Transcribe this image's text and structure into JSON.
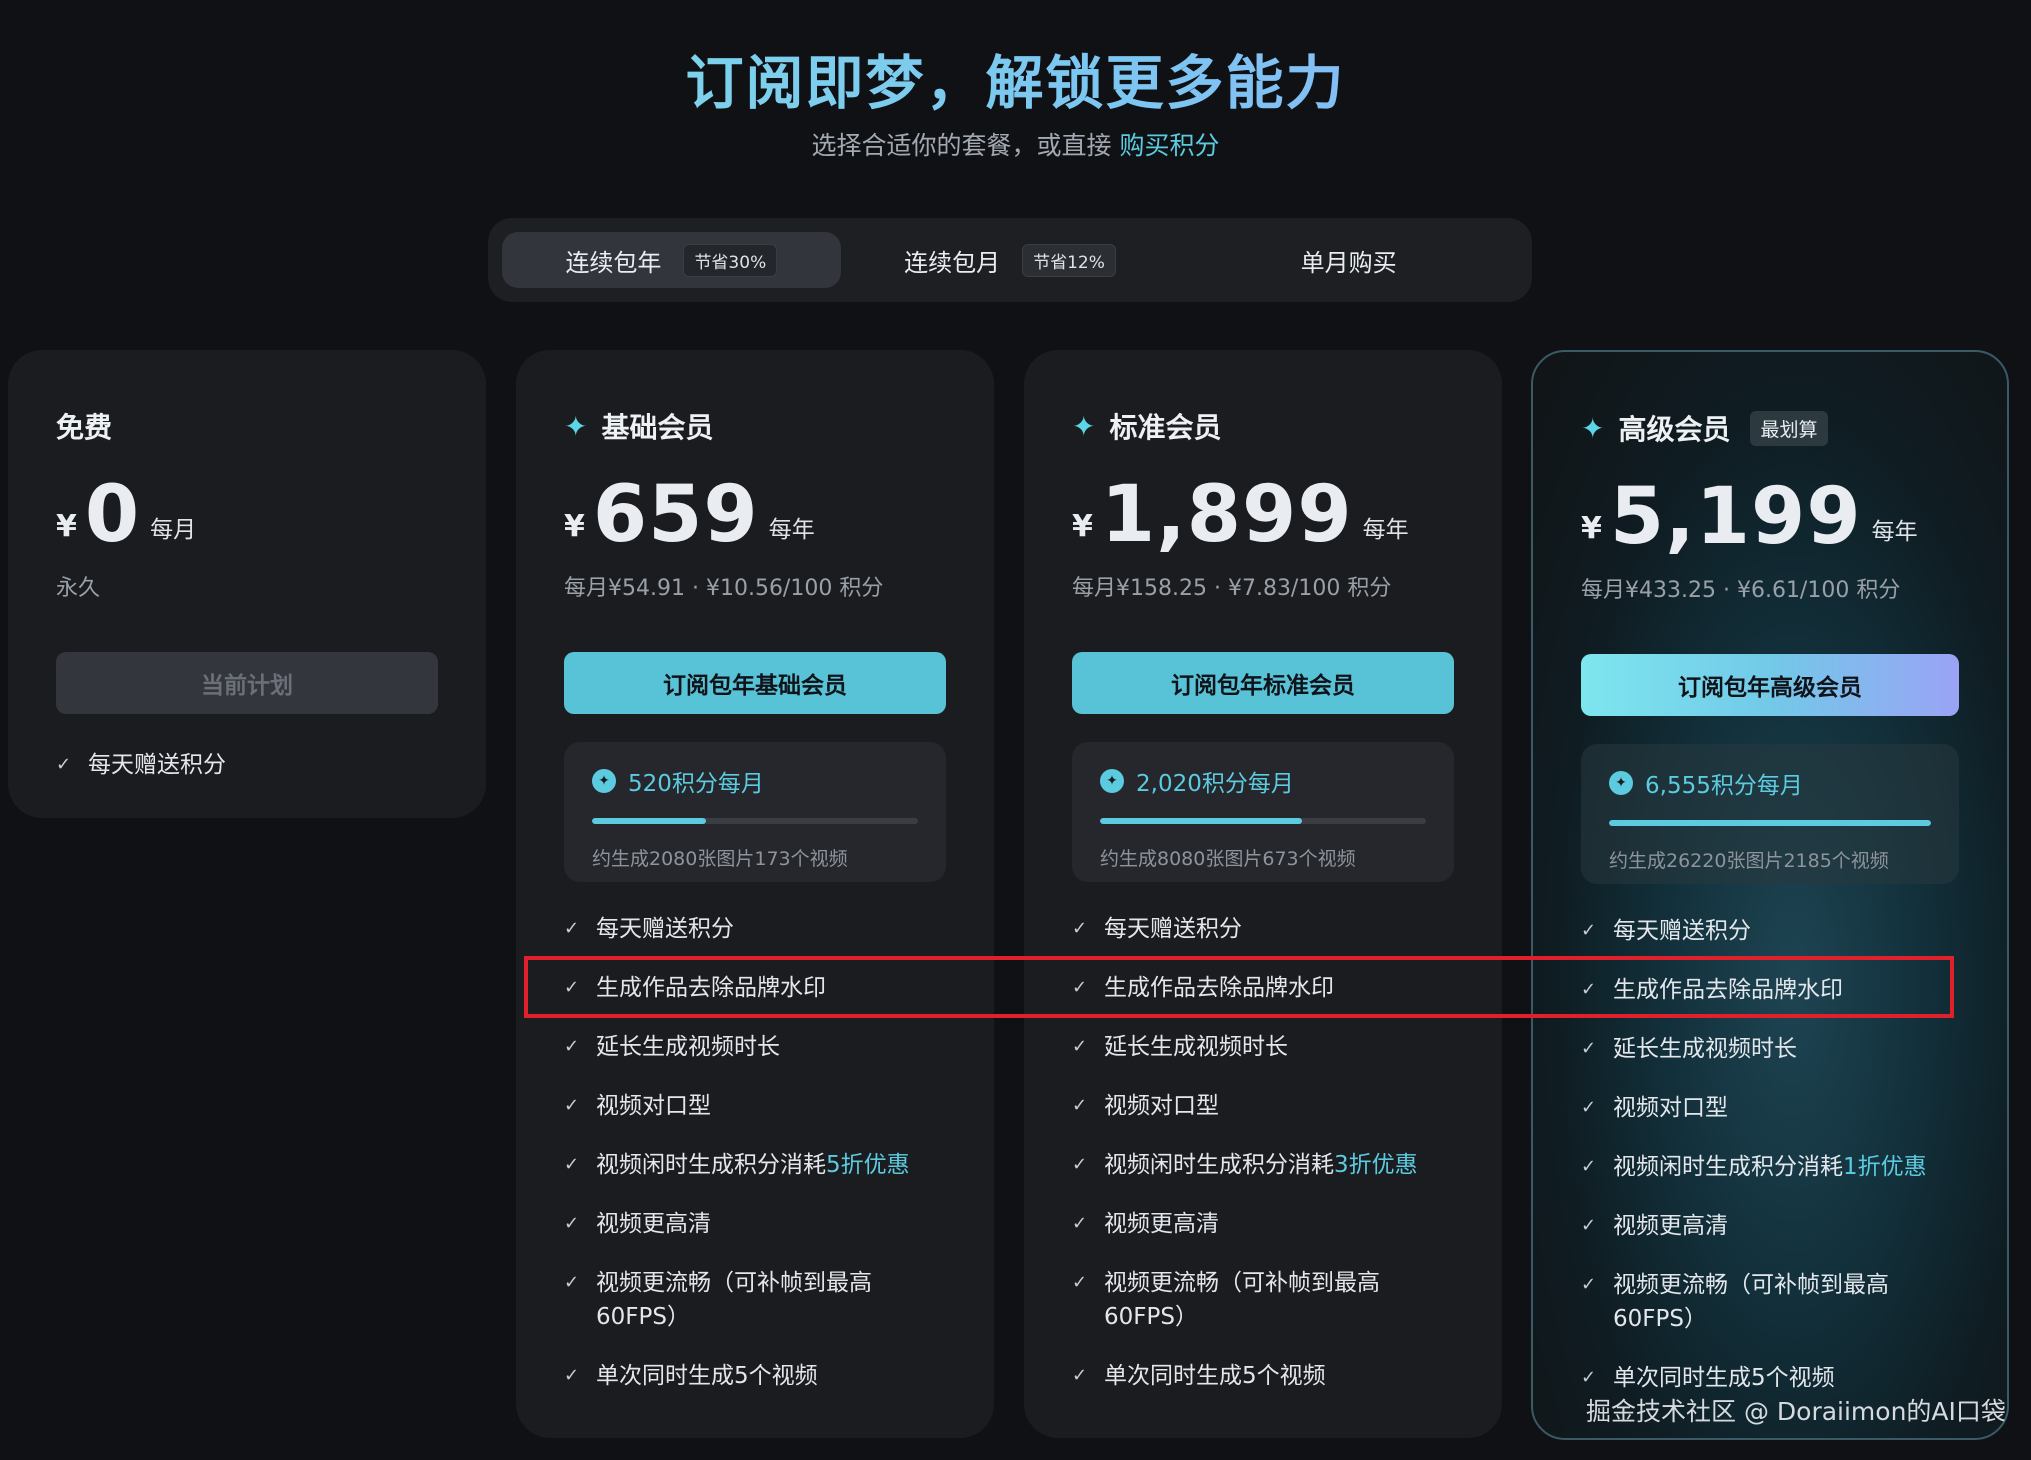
{
  "hero": {
    "title": "订阅即梦，解锁更多能力",
    "subtitle": "选择合适你的套餐，或直接",
    "subtitle_link": "购买积分"
  },
  "tabs": [
    {
      "label": "连续包年",
      "badge": "节省30%",
      "active": true
    },
    {
      "label": "连续包月",
      "badge": "节省12%",
      "active": false
    },
    {
      "label": "单月购买",
      "badge": "",
      "active": false
    }
  ],
  "plans": {
    "free": {
      "name": "免费",
      "currency": "¥",
      "amount": "0",
      "period": "每月",
      "note": "永久",
      "cta": "当前计划",
      "features": [
        "每天赠送积分"
      ]
    },
    "basic": {
      "name": "基础会员",
      "currency": "¥",
      "amount": "659",
      "period": "每年",
      "note": "每月¥54.91 · ¥10.56/100 积分",
      "cta": "订阅包年基础会员",
      "credits": "520积分每月",
      "credit_progress": 0.35,
      "estimate": "约生成2080张图片173个视频",
      "features": [
        "每天赠送积分",
        "生成作品去除品牌水印",
        "延长生成视频时长",
        "视频对口型",
        "视频闲时生成积分消耗",
        "视频更高清",
        "视频更流畅（可补帧到最高",
        "单次同时生成5个视频"
      ],
      "discount": "5折优惠",
      "fps_line2": "60FPS）"
    },
    "standard": {
      "name": "标准会员",
      "currency": "¥",
      "amount": "1,899",
      "period": "每年",
      "note": "每月¥158.25 · ¥7.83/100 积分",
      "cta": "订阅包年标准会员",
      "credits": "2,020积分每月",
      "credit_progress": 0.62,
      "estimate": "约生成8080张图片673个视频",
      "features": [
        "每天赠送积分",
        "生成作品去除品牌水印",
        "延长生成视频时长",
        "视频对口型",
        "视频闲时生成积分消耗",
        "视频更高清",
        "视频更流畅（可补帧到最高",
        "单次同时生成5个视频"
      ],
      "discount": "3折优惠",
      "fps_line2": "60FPS）"
    },
    "advanced": {
      "name": "高级会员",
      "badge": "最划算",
      "currency": "¥",
      "amount": "5,199",
      "period": "每年",
      "note": "每月¥433.25 · ¥6.61/100 积分",
      "cta": "订阅包年高级会员",
      "credits": "6,555积分每月",
      "credit_progress": 1.0,
      "estimate": "约生成26220张图片2185个视频",
      "features": [
        "每天赠送积分",
        "生成作品去除品牌水印",
        "延长生成视频时长",
        "视频对口型",
        "视频闲时生成积分消耗",
        "视频更高清",
        "视频更流畅（可补帧到最高",
        "单次同时生成5个视频"
      ],
      "discount": "1折优惠",
      "fps_line2": "60FPS）"
    }
  },
  "watermark": "掘金技术社区 @ Doraiimon的AI口袋",
  "colors": {
    "accent": "#5ccbe0",
    "highlight_box": "#e0202a",
    "background": "#101114"
  }
}
